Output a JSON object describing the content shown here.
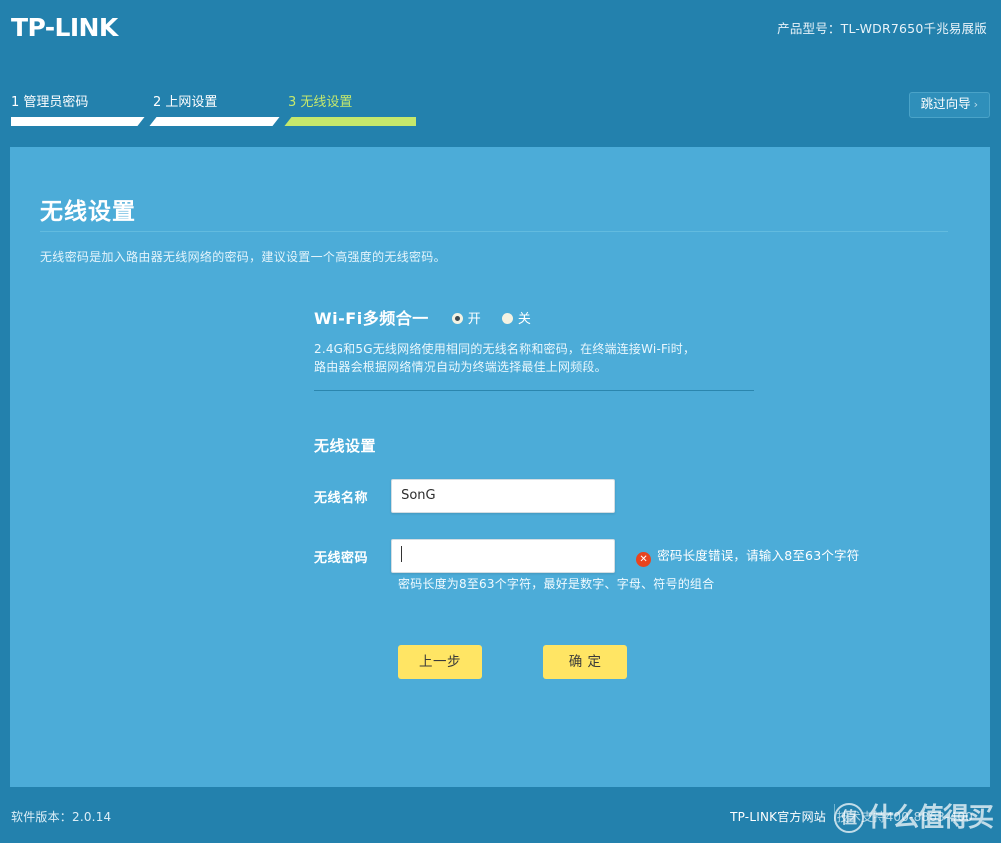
{
  "header": {
    "logo": "TP-LINK",
    "product_model": "产品型号：TL-WDR7650千兆易展版",
    "skip_wizard_label": "跳过向导",
    "skip_wizard_chevron": "›"
  },
  "steps": [
    {
      "label": "1 管理员密码",
      "state": "done"
    },
    {
      "label": "2 上网设置",
      "state": "done"
    },
    {
      "label": "3 无线设置",
      "state": "active"
    }
  ],
  "panel": {
    "title": "无线设置",
    "description": "无线密码是加入路由器无线网络的密码，建议设置一个高强度的无线密码。"
  },
  "wifi_multiband": {
    "heading": "Wi-Fi多频合一",
    "options": [
      {
        "label": "开",
        "selected": true
      },
      {
        "label": "关",
        "selected": false
      }
    ],
    "note_line1": "2.4G和5G无线网络使用相同的无线名称和密码，在终端连接Wi-Fi时，",
    "note_line2": "路由器会根据网络情况自动为终端选择最佳上网频段。"
  },
  "wireless_form": {
    "heading": "无线设置",
    "ssid": {
      "label": "无线名称",
      "value": "SonG",
      "placeholder": ""
    },
    "password": {
      "label": "无线密码",
      "value": "",
      "placeholder": "",
      "error_icon": "✕",
      "error_text": "密码长度错误，请输入8至63个字符",
      "hint": "密码长度为8至63个字符，最好是数字、字母、符号的组合"
    }
  },
  "buttons": {
    "previous": "上一步",
    "confirm": "确 定"
  },
  "footer": {
    "software_version": "软件版本：2.0.14",
    "official_site": "TP-LINK官方网站",
    "extra_link": "技术支持400-8863-400"
  },
  "watermark": {
    "badge": "值",
    "text": "什么值得买"
  },
  "colors": {
    "page_background": "#2381ad",
    "panel_background": "#4cacd8",
    "step_done": "#ffffff",
    "step_active": "#c5e86c",
    "button_yellow": "#ffe564",
    "error_red": "#e8441f"
  }
}
